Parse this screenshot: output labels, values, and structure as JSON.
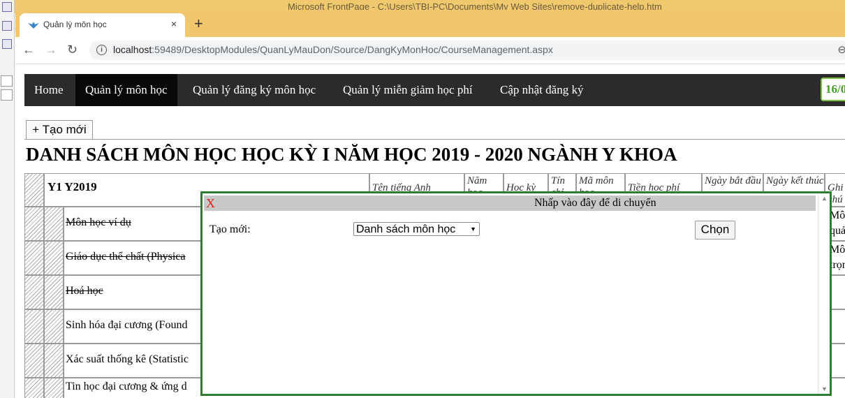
{
  "background_app": {
    "title": "Microsoft FrontPage - C:\\Users\\TBI-PC\\Documents\\My Web Sites\\remove-duplicate-help.htm"
  },
  "browser": {
    "tab_title": "Quản lý môn học",
    "tab_close": "×",
    "new_tab": "+",
    "back": "←",
    "forward": "→",
    "reload": "↻",
    "info_icon": "i",
    "url_host": "localhost",
    "url_rest": ":59489/DesktopModules/QuanLyMauDon/Source/DangKyMonHoc/CourseManagement.aspx",
    "zoom_icon": "⊖"
  },
  "nav": {
    "items": [
      {
        "label": "Home"
      },
      {
        "label": "Quản lý môn học",
        "active": true
      },
      {
        "label": "Quản lý đăng ký môn học"
      },
      {
        "label": "Quản lý miễn giảm học phí"
      },
      {
        "label": "Cập nhật đăng ký"
      }
    ],
    "date_badge": "16/0"
  },
  "toolbar": {
    "create_label": "+ Tạo mới"
  },
  "page_title": "DANH SÁCH MÔN HỌC HỌC KỲ I NĂM HỌC 2019 - 2020 NGÀNH Y KHOA",
  "table": {
    "group_label": "Y1 Y2019",
    "headers": [
      {
        "label": "Tên tiếng Anh"
      },
      {
        "label": "Năm học"
      },
      {
        "label": "Học kỳ"
      },
      {
        "label": "Tín chỉ"
      },
      {
        "label": "Mã môn học"
      },
      {
        "label": "Tiền học phí"
      },
      {
        "label": "Ngày bắt đầu"
      },
      {
        "label": "Ngày kết thúc"
      },
      {
        "label": "Ghi chú"
      }
    ],
    "rows": [
      {
        "name": "Môn học ví dụ",
        "struck": true,
        "note": "Môn quả"
      },
      {
        "name": "Giáo dục thể chất (Physica",
        "struck": true,
        "note": "Môn trọn"
      },
      {
        "name": "Hoá học",
        "struck": true,
        "note": ""
      },
      {
        "name": "Sinh hóa đại cương (Found",
        "struck": false,
        "note": ""
      },
      {
        "name": "Xác suất thống kê (Statistic",
        "struck": false,
        "note": ""
      },
      {
        "name": "Tin học đại cương & ứng d",
        "struck": false,
        "note": ""
      }
    ]
  },
  "dialog": {
    "close_label": "X",
    "drag_hint": "Nhấp vào đây để di chuyển",
    "label": "Tạo mới:",
    "select_value": "Danh sách môn học",
    "button_label": "Chọn"
  },
  "colors": {
    "tabstrip": "#f2c66d",
    "navbar": "#2b2b2b",
    "nav_active": "#080808",
    "dialog_border": "#2f7d2f",
    "close_x": "#e02020",
    "date_badge": "#7bc043"
  }
}
